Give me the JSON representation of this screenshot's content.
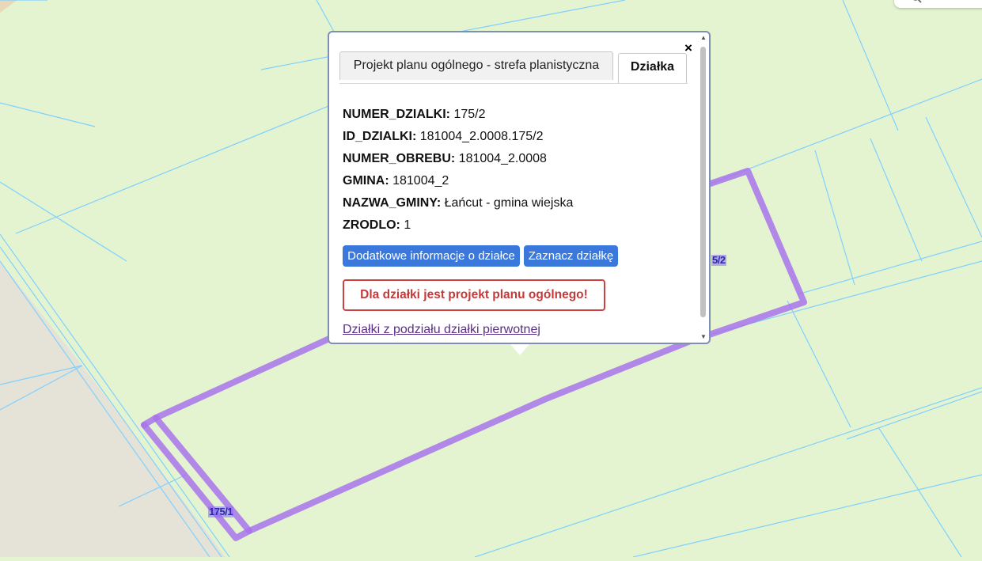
{
  "map": {
    "colors": {
      "land": "#e4f4d0",
      "road": "#e5e3d8",
      "parcel_lines": "#7fd0ff",
      "selection": "#a873ec"
    },
    "parcel_labels": [
      "175/1",
      "5/2"
    ]
  },
  "popup": {
    "close_label": "×",
    "tabs": [
      {
        "label": "Projekt planu ogólnego - strefa planistyczna",
        "active": false
      },
      {
        "label": "Działka",
        "active": true
      }
    ],
    "attributes": [
      {
        "key": "NUMER_DZIALKI:",
        "value": "175/2"
      },
      {
        "key": "ID_DZIALKI:",
        "value": "181004_2.0008.175/2"
      },
      {
        "key": "NUMER_OBREBU:",
        "value": "181004_2.0008"
      },
      {
        "key": "GMINA:",
        "value": "181004_2"
      },
      {
        "key": "NAZWA_GMINY:",
        "value": "Łańcut - gmina wiejska"
      },
      {
        "key": "ZRODLO:",
        "value": "1"
      }
    ],
    "buttons": {
      "info": "Dodatkowe informacje o działce",
      "mark": "Zaznacz działkę"
    },
    "warning": "Dla działki jest projekt planu ogólnego!",
    "link": "Działki z podziału działki pierwotnej",
    "scroll_up_icon": "▲",
    "scroll_down_icon": "▼"
  }
}
